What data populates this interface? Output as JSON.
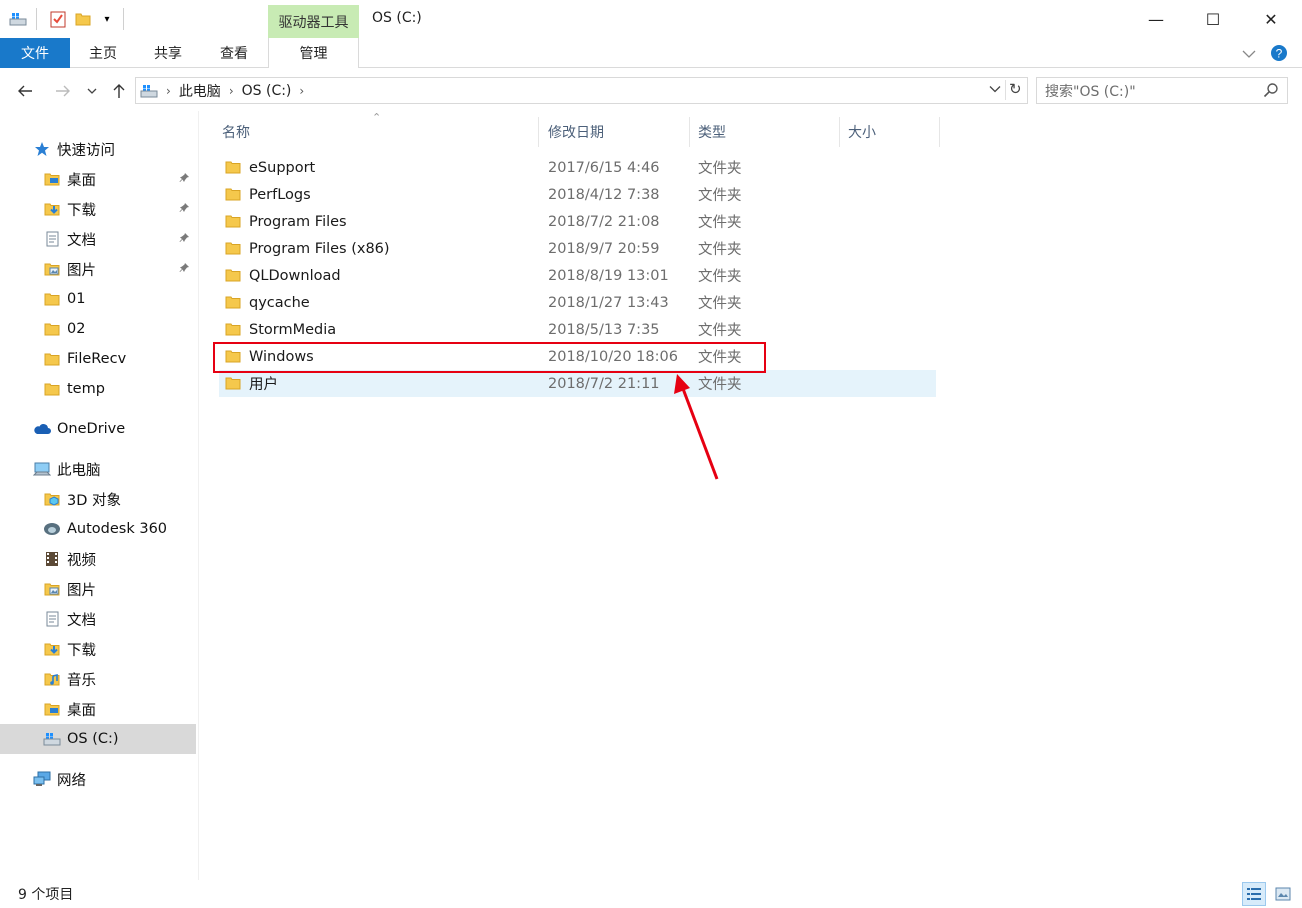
{
  "window": {
    "title": "OS (C:)",
    "context_group": "驱动器工具",
    "minimize": "—",
    "maximize": "☐",
    "close": "✕"
  },
  "ribbon": {
    "tabs": [
      {
        "label": "文件"
      },
      {
        "label": "主页"
      },
      {
        "label": "共享"
      },
      {
        "label": "查看"
      },
      {
        "label": "管理"
      }
    ]
  },
  "address": {
    "breadcrumbs": [
      "此电脑",
      "OS (C:)"
    ],
    "search_placeholder": "搜索\"OS (C:)\""
  },
  "columns": {
    "name": "名称",
    "date": "修改日期",
    "type": "类型",
    "size": "大小"
  },
  "files": [
    {
      "name": "eSupport",
      "date": "2017/6/15 4:46",
      "type": "文件夹"
    },
    {
      "name": "PerfLogs",
      "date": "2018/4/12 7:38",
      "type": "文件夹"
    },
    {
      "name": "Program Files",
      "date": "2018/7/2 21:08",
      "type": "文件夹"
    },
    {
      "name": "Program Files (x86)",
      "date": "2018/9/7 20:59",
      "type": "文件夹"
    },
    {
      "name": "QLDownload",
      "date": "2018/8/19 13:01",
      "type": "文件夹"
    },
    {
      "name": "qycache",
      "date": "2018/1/27 13:43",
      "type": "文件夹"
    },
    {
      "name": "StormMedia",
      "date": "2018/5/13 7:35",
      "type": "文件夹"
    },
    {
      "name": "Windows",
      "date": "2018/10/20 18:06",
      "type": "文件夹"
    },
    {
      "name": "用户",
      "date": "2018/7/2 21:11",
      "type": "文件夹"
    }
  ],
  "nav": {
    "quick_access": "快速访问",
    "quick_items": [
      {
        "label": "桌面",
        "icon": "desktop-folder-icon",
        "pinned": true
      },
      {
        "label": "下载",
        "icon": "download-folder-icon",
        "pinned": true
      },
      {
        "label": "文档",
        "icon": "documents-folder-icon",
        "pinned": true
      },
      {
        "label": "图片",
        "icon": "pictures-folder-icon",
        "pinned": true
      },
      {
        "label": "01",
        "icon": "folder-icon",
        "pinned": false
      },
      {
        "label": "02",
        "icon": "folder-icon",
        "pinned": false
      },
      {
        "label": "FileRecv",
        "icon": "folder-icon",
        "pinned": false
      },
      {
        "label": "temp",
        "icon": "folder-icon",
        "pinned": false
      }
    ],
    "onedrive": "OneDrive",
    "this_pc": "此电脑",
    "pc_items": [
      {
        "label": "3D 对象",
        "icon": "3d-objects-icon"
      },
      {
        "label": "Autodesk 360",
        "icon": "autodesk-360-icon"
      },
      {
        "label": "视频",
        "icon": "videos-folder-icon"
      },
      {
        "label": "图片",
        "icon": "pictures-folder-icon"
      },
      {
        "label": "文档",
        "icon": "documents-folder-icon"
      },
      {
        "label": "下载",
        "icon": "download-folder-icon"
      },
      {
        "label": "音乐",
        "icon": "music-folder-icon"
      },
      {
        "label": "桌面",
        "icon": "desktop-folder-icon"
      },
      {
        "label": "OS (C:)",
        "icon": "drive-icon"
      }
    ],
    "network": "网络"
  },
  "status": {
    "item_count": "9 个项目"
  },
  "colors": {
    "file_tab": "#1979ca",
    "context_group": "#c8ebb4",
    "hover_row": "#e5f3fb",
    "selected_nav": "#d9d9d9",
    "annotation": "#e60012",
    "folder": "#f5c84c"
  }
}
